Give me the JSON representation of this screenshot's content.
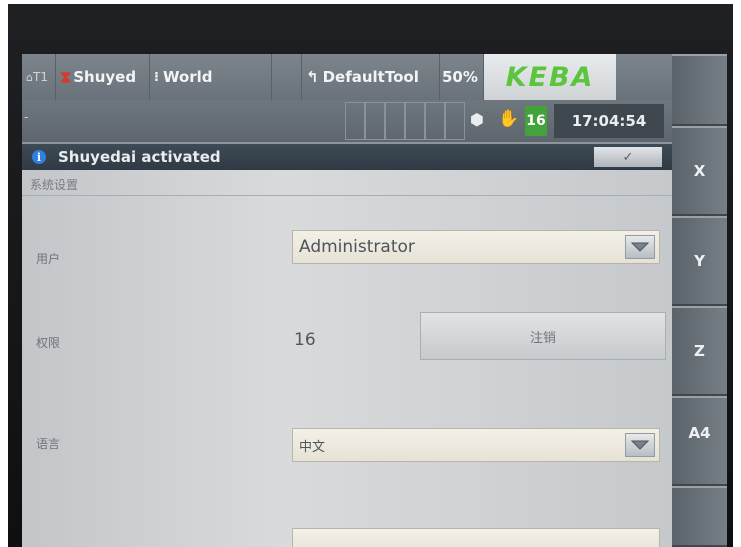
{
  "status": {
    "user_short": "T1",
    "program": "Shuyed",
    "coord": "World",
    "tool": "DefaultTool",
    "override": "50%",
    "brand": "KEBA",
    "counter": "16",
    "time": "17:04:54",
    "dash": "-"
  },
  "message": {
    "text": "Shuyedai activated",
    "ack": "✓"
  },
  "panel": {
    "title": "系统设置",
    "user_label": "用户",
    "user_value": "Administrator",
    "level_label": "权限",
    "level_value": "16",
    "logout_label": "注销",
    "lang_label": "语言",
    "lang_value": "中文"
  },
  "keys": [
    "X",
    "Y",
    "Z",
    "A4"
  ],
  "colors": {
    "brand_green": "#5cc43d",
    "info_blue": "#2f7fe0",
    "panel_bg": "#d9dadc"
  }
}
